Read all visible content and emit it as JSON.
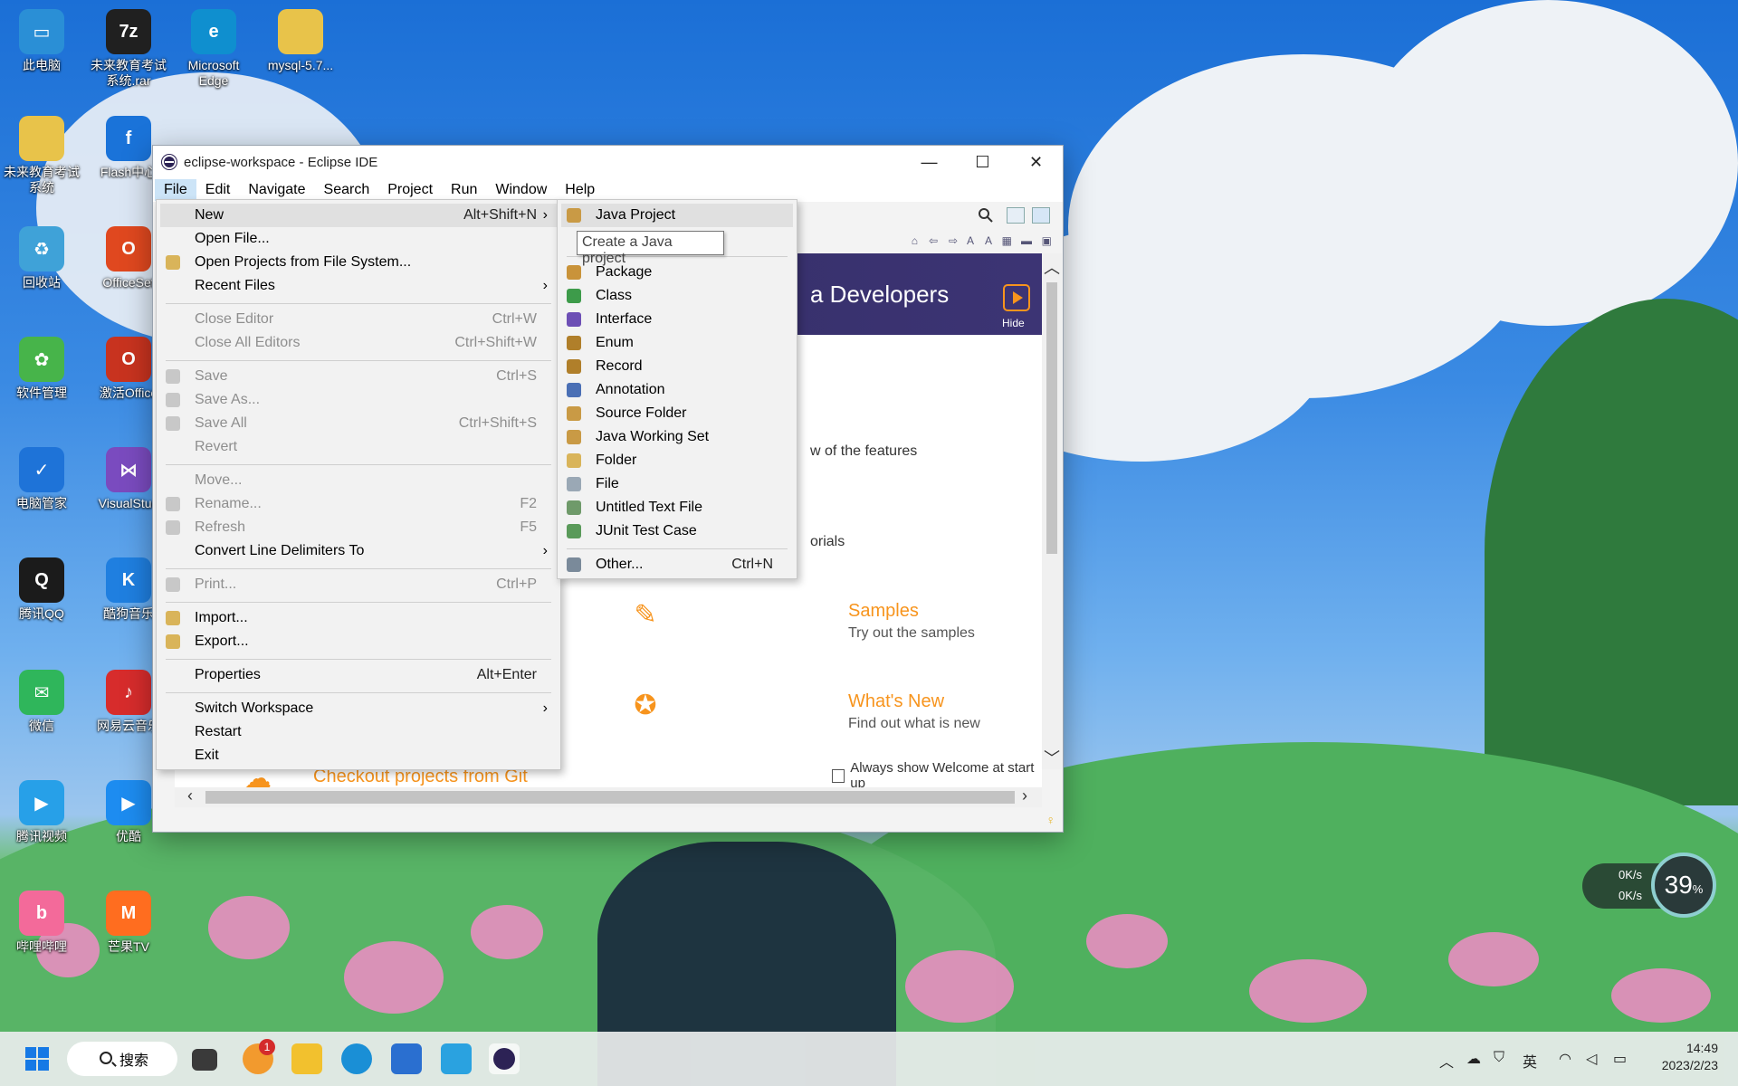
{
  "desktop": {
    "icons": [
      {
        "label": "此电脑",
        "color": "#2a8fd6",
        "glyph": "▭"
      },
      {
        "label": "未来教育考试系统.rar",
        "color": "#202020",
        "glyph": "7z"
      },
      {
        "label": "Microsoft Edge",
        "color": "#0f8fcf",
        "glyph": "e"
      },
      {
        "label": "mysql-5.7...",
        "color": "#e8c34a",
        "glyph": ""
      },
      {
        "label": "未来教育考试系统",
        "color": "#e8c34a",
        "glyph": ""
      },
      {
        "label": "Flash中心",
        "color": "#1a73d9",
        "glyph": "f"
      },
      {
        "label": "回收站",
        "color": "#3fa2d8",
        "glyph": "♻"
      },
      {
        "label": "OfficeSet",
        "color": "#e0481f",
        "glyph": "O"
      },
      {
        "label": "软件管理",
        "color": "#47b44a",
        "glyph": "✿"
      },
      {
        "label": "激活Office",
        "color": "#c8331f",
        "glyph": "O"
      },
      {
        "label": "电脑管家",
        "color": "#1e73d8",
        "glyph": "✓"
      },
      {
        "label": "VisualStud",
        "color": "#7a4bbf",
        "glyph": "⋈"
      },
      {
        "label": "腾讯QQ",
        "color": "#1b1b1b",
        "glyph": "Q"
      },
      {
        "label": "酷狗音乐",
        "color": "#1f7fe0",
        "glyph": "K"
      },
      {
        "label": "微信",
        "color": "#2fb65b",
        "glyph": "✉"
      },
      {
        "label": "网易云音乐",
        "color": "#d72c2c",
        "glyph": "♪"
      },
      {
        "label": "腾讯视频",
        "color": "#27a0e8",
        "glyph": "▶"
      },
      {
        "label": "优酷",
        "color": "#1d8cf0",
        "glyph": "▶"
      },
      {
        "label": "哔哩哔哩",
        "color": "#f36a9a",
        "glyph": "b"
      },
      {
        "label": "芒果TV",
        "color": "#ff6d1f",
        "glyph": "M"
      }
    ]
  },
  "window": {
    "title": "eclipse-workspace - Eclipse IDE",
    "controls": {
      "minimize": "—",
      "maximize": "☐",
      "close": "✕"
    }
  },
  "menubar": [
    "File",
    "Edit",
    "Navigate",
    "Search",
    "Project",
    "Run",
    "Window",
    "Help"
  ],
  "file_menu": [
    {
      "label": "New",
      "shortcut": "Alt+Shift+N",
      "submenu": true,
      "highlight": true
    },
    {
      "label": "Open File...",
      "shortcut": ""
    },
    {
      "label": "Open Projects from File System...",
      "shortcut": "",
      "icon": "folder-icon"
    },
    {
      "label": "Recent Files",
      "shortcut": "",
      "submenu": true
    },
    {
      "sep": true
    },
    {
      "label": "Close Editor",
      "shortcut": "Ctrl+W",
      "disabled": true
    },
    {
      "label": "Close All Editors",
      "shortcut": "Ctrl+Shift+W",
      "disabled": true
    },
    {
      "sep": true
    },
    {
      "label": "Save",
      "shortcut": "Ctrl+S",
      "disabled": true,
      "icon": "save-icon"
    },
    {
      "label": "Save As...",
      "shortcut": "",
      "disabled": true,
      "icon": "save-as-icon"
    },
    {
      "label": "Save All",
      "shortcut": "Ctrl+Shift+S",
      "disabled": true,
      "icon": "save-all-icon"
    },
    {
      "label": "Revert",
      "shortcut": "",
      "disabled": true
    },
    {
      "sep": true
    },
    {
      "label": "Move...",
      "shortcut": "",
      "disabled": true
    },
    {
      "label": "Rename...",
      "shortcut": "F2",
      "disabled": true,
      "icon": "rename-icon"
    },
    {
      "label": "Refresh",
      "shortcut": "F5",
      "disabled": true,
      "icon": "refresh-icon"
    },
    {
      "label": "Convert Line Delimiters To",
      "shortcut": "",
      "submenu": true
    },
    {
      "sep": true
    },
    {
      "label": "Print...",
      "shortcut": "Ctrl+P",
      "disabled": true,
      "icon": "print-icon"
    },
    {
      "sep": true
    },
    {
      "label": "Import...",
      "shortcut": "",
      "icon": "import-icon"
    },
    {
      "label": "Export...",
      "shortcut": "",
      "icon": "export-icon"
    },
    {
      "sep": true
    },
    {
      "label": "Properties",
      "shortcut": "Alt+Enter"
    },
    {
      "sep": true
    },
    {
      "label": "Switch Workspace",
      "shortcut": "",
      "submenu": true
    },
    {
      "label": "Restart",
      "shortcut": ""
    },
    {
      "label": "Exit",
      "shortcut": ""
    }
  ],
  "new_submenu": [
    {
      "label": "Java Project",
      "icon": "java-project-icon",
      "color": "#c99a45",
      "highlight": true
    },
    {
      "gap": true
    },
    {
      "sep": true
    },
    {
      "label": "Package",
      "icon": "package-icon",
      "color": "#c9933a"
    },
    {
      "label": "Class",
      "icon": "class-icon",
      "color": "#3d9b4a"
    },
    {
      "label": "Interface",
      "icon": "interface-icon",
      "color": "#6d4fb5"
    },
    {
      "label": "Enum",
      "icon": "enum-icon",
      "color": "#b07f2a"
    },
    {
      "label": "Record",
      "icon": "record-icon",
      "color": "#b07f2a"
    },
    {
      "label": "Annotation",
      "icon": "annotation-icon",
      "color": "#4a6fb5"
    },
    {
      "label": "Source Folder",
      "icon": "source-folder-icon",
      "color": "#c99a45"
    },
    {
      "label": "Java Working Set",
      "icon": "working-set-icon",
      "color": "#c99a45"
    },
    {
      "label": "Folder",
      "icon": "folder-icon",
      "color": "#d9b45a"
    },
    {
      "label": "File",
      "icon": "file-icon",
      "color": "#9aa8b5"
    },
    {
      "label": "Untitled Text File",
      "icon": "text-file-icon",
      "color": "#6f9a6a"
    },
    {
      "label": "JUnit Test Case",
      "icon": "junit-icon",
      "color": "#5a9a5a"
    },
    {
      "sep": true
    },
    {
      "label": "Other...",
      "shortcut": "Ctrl+N",
      "icon": "other-icon",
      "color": "#7a8a9a"
    }
  ],
  "tooltip": "Create a Java project",
  "welcome": {
    "banner_title": "a Developers",
    "hide_label": "Hide",
    "overview_fragment": "w of the features",
    "tutorials_fragment": "orials",
    "samples_title": "Samples",
    "samples_sub": "Try out the samples",
    "whatsnew_title": "What's New",
    "whatsnew_sub": "Find out what is new",
    "checkout_title": "Checkout projects from Git",
    "always_show": "Always show Welcome at start up"
  },
  "taskbar": {
    "search_label": "搜索",
    "badge": "1",
    "ime": "英",
    "time": "14:49",
    "date": "2023/2/23"
  },
  "network_widget": {
    "up": "0K/s",
    "down": "0K/s",
    "percent": "39",
    "percent_unit": "%"
  }
}
